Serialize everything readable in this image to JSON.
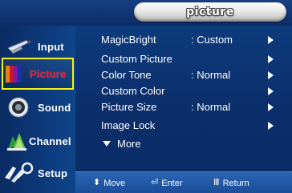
{
  "title": "picture",
  "sidebar": {
    "items": [
      {
        "label": "Input",
        "icon": "input-icon"
      },
      {
        "label": "Picture",
        "icon": "picture-icon",
        "selected": true
      },
      {
        "label": "Sound",
        "icon": "sound-icon"
      },
      {
        "label": "Channel",
        "icon": "channel-icon"
      },
      {
        "label": "Setup",
        "icon": "setup-icon"
      }
    ]
  },
  "menu": {
    "items": [
      {
        "label": "MagicBright",
        "value": ": Custom",
        "arrow": true
      },
      {
        "label": "Custom Picture",
        "value": "",
        "arrow": true
      },
      {
        "label": "Color Tone",
        "value": ": Normal",
        "arrow": true
      },
      {
        "label": "Custom Color",
        "value": "",
        "arrow": true
      },
      {
        "label": "Picture Size",
        "value": ": Normal",
        "arrow": true
      },
      {
        "label": "Image Lock",
        "value": "",
        "arrow": true
      }
    ],
    "more_label": "More"
  },
  "help": {
    "move": {
      "glyph": "⬍",
      "label": "Move"
    },
    "enter": {
      "glyph": "⏎",
      "label": "Enter"
    },
    "return": {
      "glyph": "Ⅲ",
      "label": "Return"
    }
  },
  "colors": {
    "selected_border": "#f2f21a",
    "active_label": "#e8192f",
    "background": "#0d3f82"
  }
}
